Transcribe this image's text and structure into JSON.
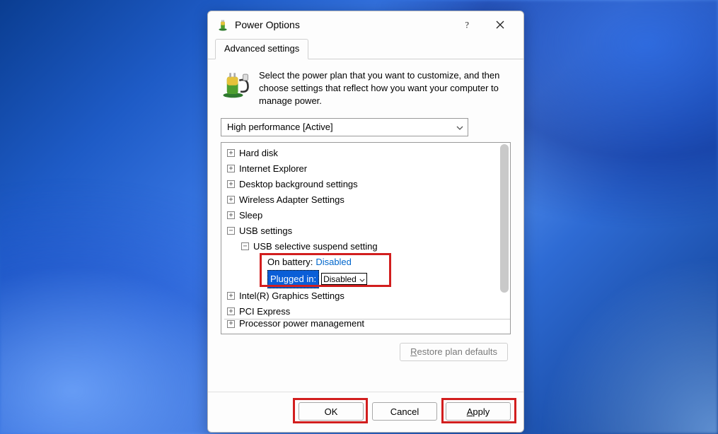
{
  "window": {
    "title": "Power Options"
  },
  "tabs": {
    "advanced": "Advanced settings"
  },
  "intro": {
    "text": "Select the power plan that you want to customize, and then choose settings that reflect how you want your computer to manage power."
  },
  "plan": {
    "selected": "High performance [Active]"
  },
  "tree": {
    "hard_disk": "Hard disk",
    "ie": "Internet Explorer",
    "desktop_bg": "Desktop background settings",
    "wireless": "Wireless Adapter Settings",
    "sleep": "Sleep",
    "usb_settings": "USB settings",
    "usb_selective": "USB selective suspend setting",
    "on_battery_label": "On battery:",
    "on_battery_value": "Disabled",
    "plugged_in_label": "Plugged in:",
    "plugged_in_value": "Disabled",
    "intel_gfx": "Intel(R) Graphics Settings",
    "pci_express": "PCI Express",
    "processor": "Processor power management"
  },
  "buttons": {
    "restore": {
      "ul": "R",
      "rest": "estore plan defaults"
    },
    "ok": "OK",
    "cancel": "Cancel",
    "apply": {
      "ul": "A",
      "rest": "pply"
    }
  }
}
